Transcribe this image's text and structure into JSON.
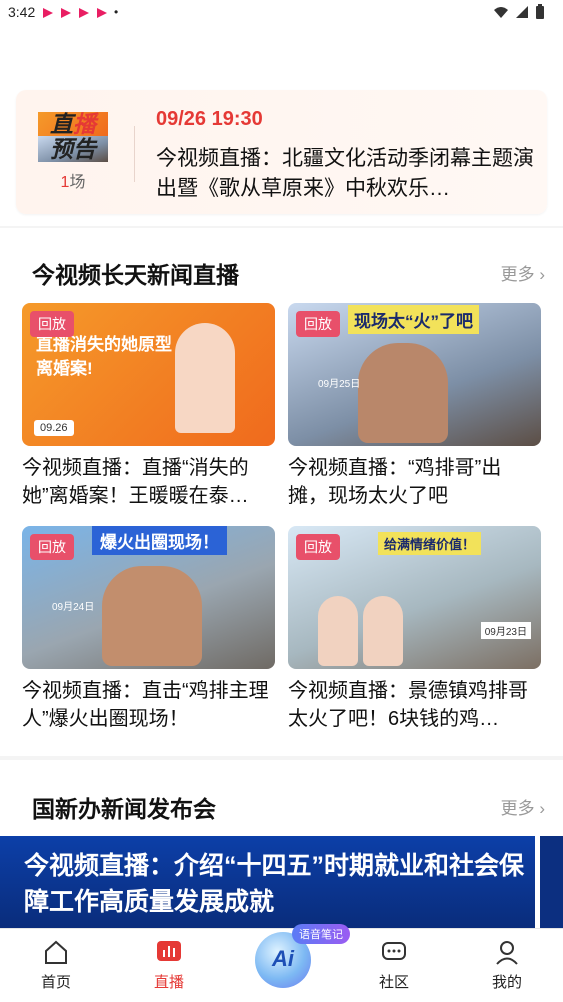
{
  "status_bar": {
    "time": "3:42",
    "dot": "•"
  },
  "preview": {
    "logo_line1_a": "直",
    "logo_line1_b": "播",
    "logo_line2": "预告",
    "count_num": "1",
    "count_unit": "场",
    "date": "09/26 19:30",
    "title": "今视频直播：北疆文化活动季闭幕主题演出暨《歌从草原来》中秋欢乐…"
  },
  "section1": {
    "title": "今视频长天新闻直播",
    "more": "更多",
    "cards": [
      {
        "badge": "回放",
        "caption": "今视频直播：直播“消失的她”离婚案！王暖暖在泰…",
        "overlay": "直播消失的她原型离婚案!",
        "date": "09.26"
      },
      {
        "badge": "回放",
        "caption": "今视频直播：“鸡排哥”出摊，现场太火了吧",
        "overlay": "现场太“火”了吧",
        "date": "09月25日"
      },
      {
        "badge": "回放",
        "caption": "今视频直播：直击“鸡排主理人”爆火出圈现场！",
        "overlay": "爆火出圈现场！",
        "date": "09月24日"
      },
      {
        "badge": "回放",
        "caption": "今视频直播：景德镇鸡排哥太火了吧！6块钱的鸡…",
        "overlay": "给满情绪价值！",
        "date": "09月23日"
      }
    ]
  },
  "section2": {
    "title": "国新办新闻发布会",
    "more": "更多",
    "banner_text": "今视频直播：介绍“十四五”时期就业和社会保障工作高质量发展成就"
  },
  "ai": {
    "label": "Ai",
    "note": "语音笔记"
  },
  "tabbar": {
    "items": [
      {
        "label": "首页",
        "icon": "home-icon"
      },
      {
        "label": "直播",
        "icon": "live-icon"
      },
      {
        "label": "社区",
        "icon": "community-icon"
      },
      {
        "label": "我的",
        "icon": "profile-icon"
      }
    ]
  },
  "colors": {
    "accent": "#e53935",
    "badge": "#e8506a",
    "banner": "#0c3fa8"
  }
}
